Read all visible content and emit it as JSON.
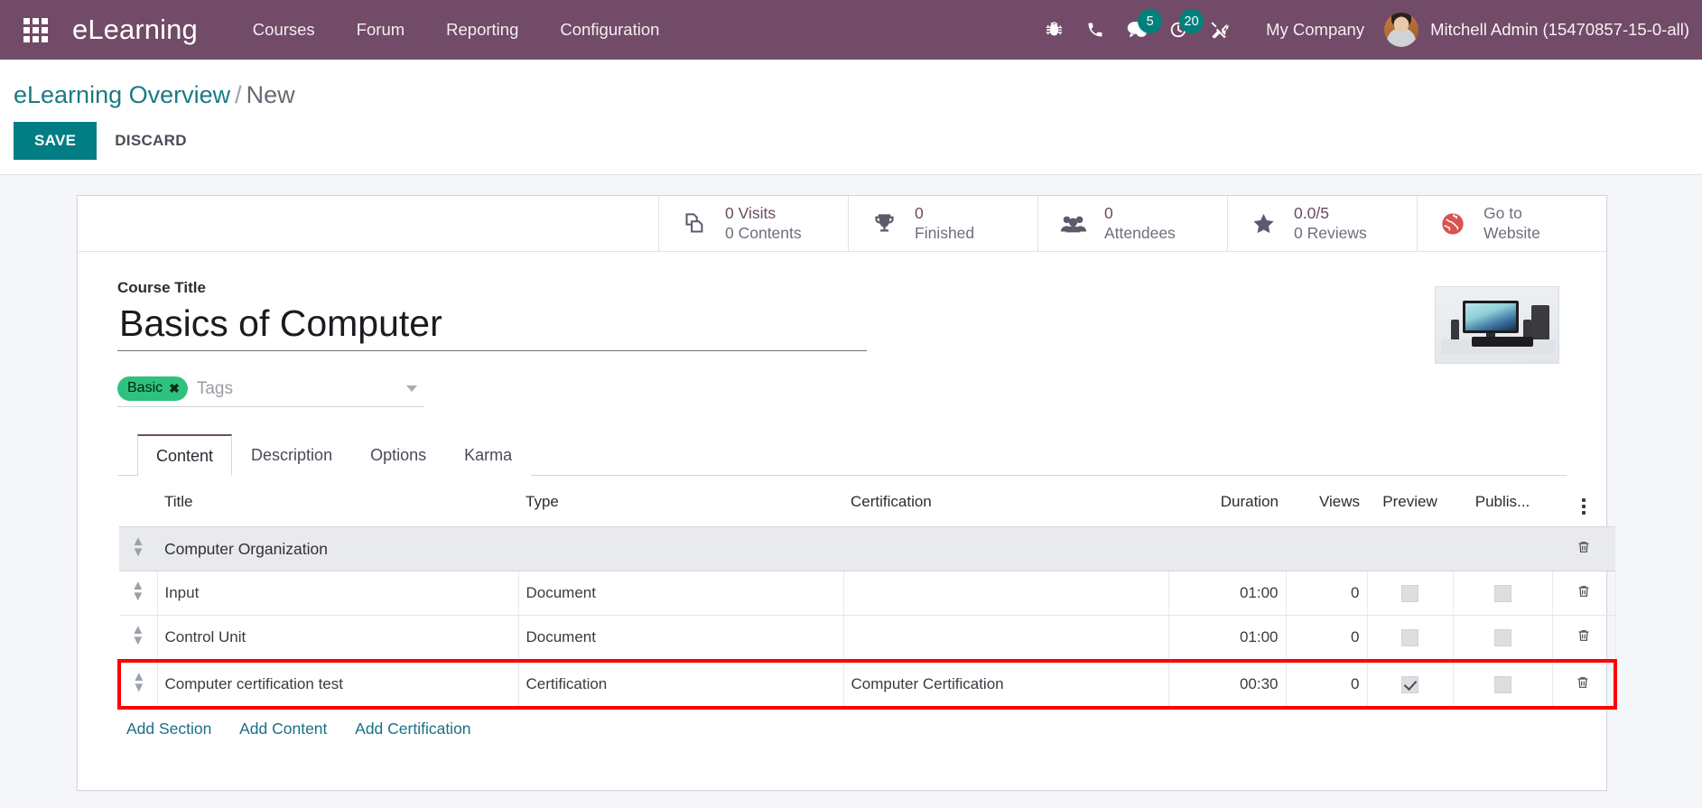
{
  "navbar": {
    "apps_icon": "apps-grid-icon",
    "brand": "eLearning",
    "menu": [
      {
        "label": "Courses"
      },
      {
        "label": "Forum"
      },
      {
        "label": "Reporting"
      },
      {
        "label": "Configuration"
      }
    ],
    "icons": [
      {
        "name": "bug-icon",
        "badge": null
      },
      {
        "name": "phone-icon",
        "badge": null
      },
      {
        "name": "messages-icon",
        "badge": "5"
      },
      {
        "name": "activities-clock-icon",
        "badge": "20"
      },
      {
        "name": "tools-wrench-icon",
        "badge": null
      }
    ],
    "company": "My Company",
    "user": "Mitchell Admin (15470857-15-0-all)",
    "bg_color": "#714B67",
    "badge_color": "#00807b"
  },
  "control_panel": {
    "breadcrumb_root": "eLearning Overview",
    "breadcrumb_sep": "/",
    "breadcrumb_current": "New",
    "save_label": "SAVE",
    "discard_label": "DISCARD",
    "save_color": "#017e84"
  },
  "stat_buttons": [
    {
      "icon": "contents-pages-icon",
      "line1": "0 Visits",
      "line2": "0 Contents"
    },
    {
      "icon": "trophy-icon",
      "line1": "0",
      "line2": "Finished"
    },
    {
      "icon": "attendees-people-icon",
      "line1": "0",
      "line2": "Attendees"
    },
    {
      "icon": "star-icon",
      "line1": "0.0/5",
      "line2": "0 Reviews"
    },
    {
      "icon": "globe-website-icon",
      "line1": "Go to",
      "line2": "Website"
    }
  ],
  "form": {
    "course_title_label": "Course Title",
    "course_title_value": "Basics of Computer",
    "tags": [
      {
        "label": "Basic",
        "color": "#2fc17e",
        "remove_icon": "tag-remove-icon"
      }
    ],
    "tags_placeholder": "Tags",
    "course_image_alt": "computer-desk-thumbnail"
  },
  "tabs": [
    {
      "label": "Content",
      "active": true
    },
    {
      "label": "Description",
      "active": false
    },
    {
      "label": "Options",
      "active": false
    },
    {
      "label": "Karma",
      "active": false
    }
  ],
  "content_table": {
    "headers": {
      "title": "Title",
      "type": "Type",
      "certification": "Certification",
      "duration": "Duration",
      "views": "Views",
      "preview": "Preview",
      "published": "Publis...",
      "options_icon": "kebab-menu-icon"
    },
    "rows": [
      {
        "kind": "section",
        "title": "Computer Organization",
        "type": "",
        "certification": "",
        "duration": "",
        "views": "",
        "preview": false,
        "published": false,
        "highlighted": false
      },
      {
        "kind": "content",
        "title": "Input",
        "type": "Document",
        "certification": "",
        "duration": "01:00",
        "views": "0",
        "preview": false,
        "published": false,
        "highlighted": false
      },
      {
        "kind": "content",
        "title": "Control Unit",
        "type": "Document",
        "certification": "",
        "duration": "01:00",
        "views": "0",
        "preview": false,
        "published": false,
        "highlighted": false
      },
      {
        "kind": "content",
        "title": "Computer certification test",
        "type": "Certification",
        "certification": "Computer Certification",
        "duration": "00:30",
        "views": "0",
        "preview": true,
        "published": false,
        "highlighted": true
      }
    ],
    "add_links": [
      {
        "label": "Add Section"
      },
      {
        "label": "Add Content"
      },
      {
        "label": "Add Certification"
      }
    ],
    "highlight_color": "#ff0000"
  }
}
